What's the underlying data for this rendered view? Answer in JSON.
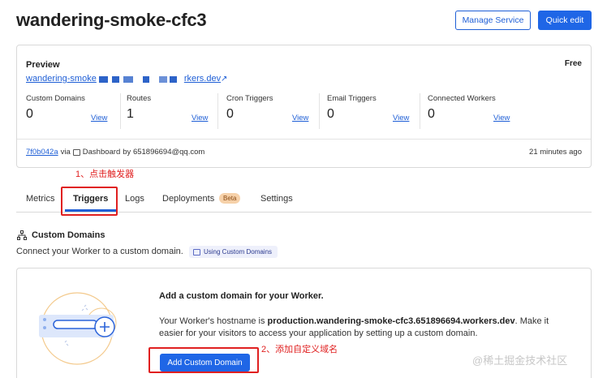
{
  "header": {
    "title": "wandering-smoke-cfc3",
    "manage_label": "Manage Service",
    "quick_edit_label": "Quick edit"
  },
  "preview": {
    "label": "Preview",
    "plan": "Free",
    "url_start": "wandering-smoke",
    "url_end": "rkers.dev"
  },
  "stats": [
    {
      "label": "Custom Domains",
      "value": "0",
      "view": "View"
    },
    {
      "label": "Routes",
      "value": "1",
      "view": "View"
    },
    {
      "label": "Cron Triggers",
      "value": "0",
      "view": "View"
    },
    {
      "label": "Email Triggers",
      "value": "0",
      "view": "View"
    },
    {
      "label": "Connected Workers",
      "value": "0",
      "view": "View"
    }
  ],
  "deployment": {
    "hash": "7f0b042a",
    "via": "via",
    "source": "Dashboard",
    "by": "by 651896694@qq.com",
    "time": "21 minutes ago"
  },
  "annotations": {
    "step1": "1、点击触发器",
    "step2": "2、添加自定义域名"
  },
  "tabs": [
    {
      "label": "Metrics"
    },
    {
      "label": "Triggers",
      "active": true
    },
    {
      "label": "Logs"
    },
    {
      "label": "Deployments",
      "badge": "Beta"
    },
    {
      "label": "Settings"
    }
  ],
  "custom_domains": {
    "title": "Custom Domains",
    "description": "Connect your Worker to a custom domain.",
    "doc_link": "Using Custom Domains",
    "cta_title": "Add a custom domain for your Worker.",
    "cta_text_before": "Your Worker's hostname is ",
    "hostname": "production.wandering-smoke-cfc3.651896694.workers.dev",
    "cta_text_after": ". Make it easier for your visitors to access your application by setting up a custom domain.",
    "button": "Add Custom Domain"
  },
  "watermark": "@稀土掘金技术社区",
  "colors": {
    "accent": "#1f66e6",
    "annotation": "#e02020",
    "beta_badge": "#f6d1a9"
  }
}
